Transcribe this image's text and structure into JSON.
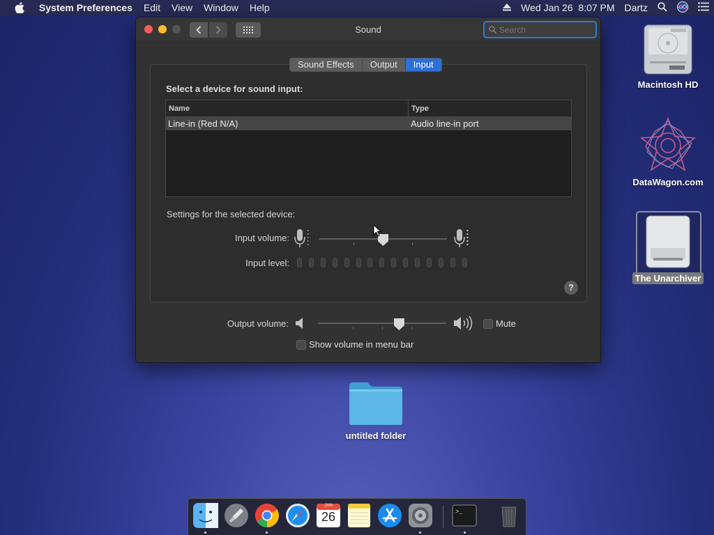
{
  "menubar": {
    "apple_icon": "apple-logo-icon",
    "app_name": "System Preferences",
    "menus": [
      "Edit",
      "View",
      "Window",
      "Help"
    ],
    "clock": "Wed Jan 26  8:07 PM",
    "user": "Dartz",
    "icons": [
      "eject-icon",
      "spotlight-icon",
      "siri-icon",
      "notification-center-icon"
    ]
  },
  "window": {
    "title": "Sound",
    "search_placeholder": "Search",
    "tabs": [
      {
        "label": "Sound Effects",
        "active": false
      },
      {
        "label": "Output",
        "active": false
      },
      {
        "label": "Input",
        "active": true
      }
    ],
    "input_pane": {
      "section_title": "Select a device for sound input:",
      "table": {
        "columns": [
          "Name",
          "Type"
        ],
        "rows": [
          {
            "name": "Line-in (Red N/A)",
            "type": "Audio line-in port",
            "selected": true
          }
        ]
      },
      "settings_title": "Settings for the selected device:",
      "input_volume_label": "Input volume:",
      "input_volume_value": 0.5,
      "input_level_label": "Input level:",
      "input_level_segments": 15,
      "input_level_active": 0,
      "help_label": "?"
    },
    "output_volume_label": "Output volume:",
    "output_volume_value": 0.63,
    "mute_label": "Mute",
    "mute_checked": false,
    "show_volume_label": "Show volume in menu bar",
    "show_volume_checked": false
  },
  "desktop": {
    "icons": [
      {
        "label": "Macintosh HD",
        "icon": "hard-drive-icon"
      },
      {
        "label": "DataWagon.com",
        "icon": "datawagon-logo-icon"
      },
      {
        "label": "The Unarchiver",
        "icon": "removable-drive-icon",
        "selected": true
      },
      {
        "label": "untitled folder",
        "icon": "folder-icon"
      }
    ]
  },
  "dock": {
    "apps": [
      {
        "name": "Finder",
        "icon": "finder-icon",
        "running": true
      },
      {
        "name": "Launchpad",
        "icon": "launchpad-icon",
        "running": false
      },
      {
        "name": "Google Chrome",
        "icon": "chrome-icon",
        "running": true
      },
      {
        "name": "Safari",
        "icon": "safari-icon",
        "running": false
      },
      {
        "name": "Calendar",
        "icon": "calendar-icon",
        "running": false,
        "month": "JAN",
        "day": "26"
      },
      {
        "name": "Notes",
        "icon": "notes-icon",
        "running": false
      },
      {
        "name": "App Store",
        "icon": "app-store-icon",
        "running": false
      },
      {
        "name": "System Preferences",
        "icon": "system-preferences-icon",
        "running": true
      },
      {
        "name": "Terminal",
        "icon": "terminal-icon",
        "running": true
      },
      {
        "name": "Trash",
        "icon": "trash-icon",
        "running": false
      }
    ]
  },
  "colors": {
    "accent": "#2d6fd6",
    "close": "#fd5c55",
    "minimize": "#febd2e"
  }
}
